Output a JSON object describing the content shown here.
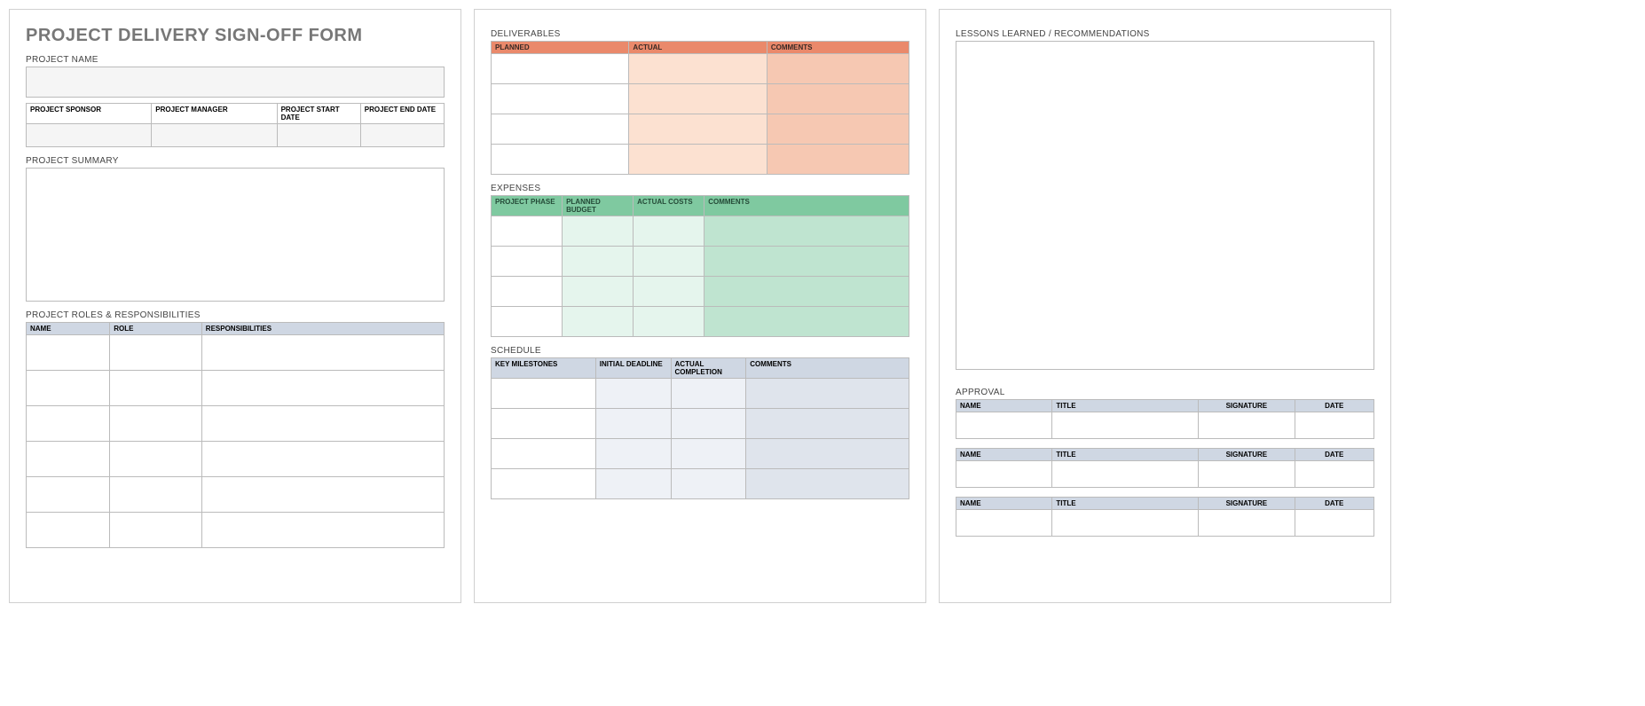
{
  "form": {
    "title": "PROJECT DELIVERY SIGN-OFF FORM",
    "project_name_label": "PROJECT NAME",
    "info_labels": {
      "sponsor": "PROJECT SPONSOR",
      "manager": "PROJECT MANAGER",
      "start": "PROJECT START DATE",
      "end": "PROJECT END DATE"
    },
    "summary_label": "PROJECT SUMMARY",
    "roles_label": "PROJECT ROLES & RESPONSIBILITIES",
    "roles_headers": {
      "name": "NAME",
      "role": "ROLE",
      "resp": "RESPONSIBILITIES"
    }
  },
  "deliverables": {
    "label": "DELIVERABLES",
    "headers": {
      "planned": "PLANNED",
      "actual": "ACTUAL",
      "comments": "COMMENTS"
    }
  },
  "expenses": {
    "label": "EXPENSES",
    "headers": {
      "phase": "PROJECT PHASE",
      "budget": "PLANNED BUDGET",
      "actual": "ACTUAL COSTS",
      "comments": "COMMENTS"
    }
  },
  "schedule": {
    "label": "SCHEDULE",
    "headers": {
      "milestone": "KEY MILESTONES",
      "initial": "INITIAL DEADLINE",
      "actual": "ACTUAL COMPLETION",
      "comments": "COMMENTS"
    }
  },
  "lessons": {
    "label": "LESSONS LEARNED / RECOMMENDATIONS"
  },
  "approval": {
    "label": "APPROVAL",
    "headers": {
      "name": "NAME",
      "title": "TITLE",
      "sig": "SIGNATURE",
      "date": "DATE"
    }
  }
}
